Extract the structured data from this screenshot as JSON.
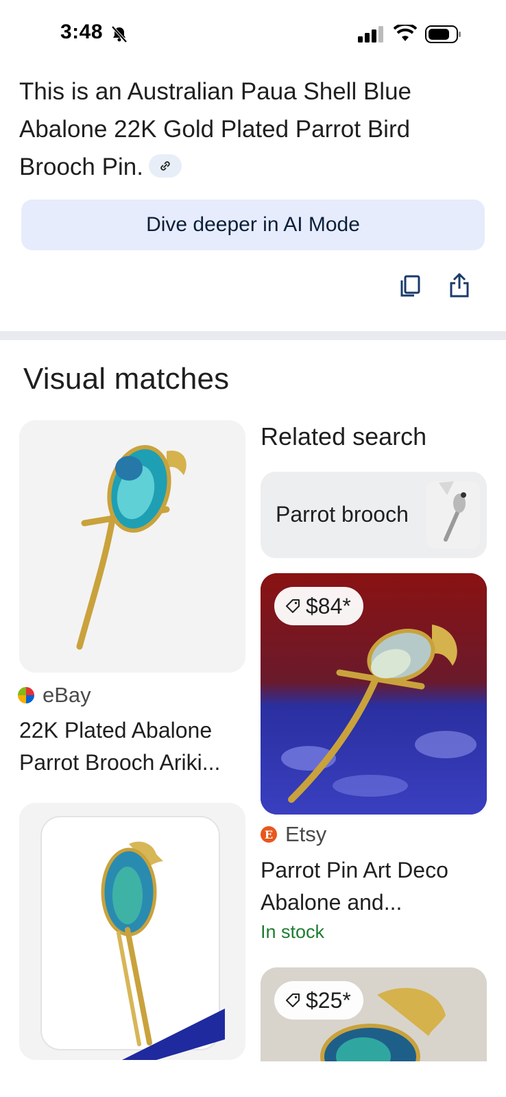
{
  "status_bar": {
    "time": "3:48"
  },
  "answer": {
    "text": "This is an Australian Paua Shell Blue Abalone 22K Gold Plated Parrot Bird Brooch Pin."
  },
  "dive_button": {
    "label": "Dive deeper in AI Mode"
  },
  "visual_matches": {
    "title": "Visual matches",
    "related": {
      "title": "Related search",
      "chip_label": "Parrot brooch"
    },
    "results": [
      {
        "source": "eBay",
        "title": "22K Plated Abalone Parrot Brooch Ariki..."
      },
      {
        "source": "Etsy",
        "title": "Parrot Pin Art Deco Abalone and...",
        "price": "$84*",
        "availability": "In stock"
      },
      {
        "price": "$25*"
      }
    ]
  },
  "colors": {
    "accent_bg": "#e6ecfb",
    "in_stock": "#1e7d32",
    "etsy": "#e8571c"
  }
}
